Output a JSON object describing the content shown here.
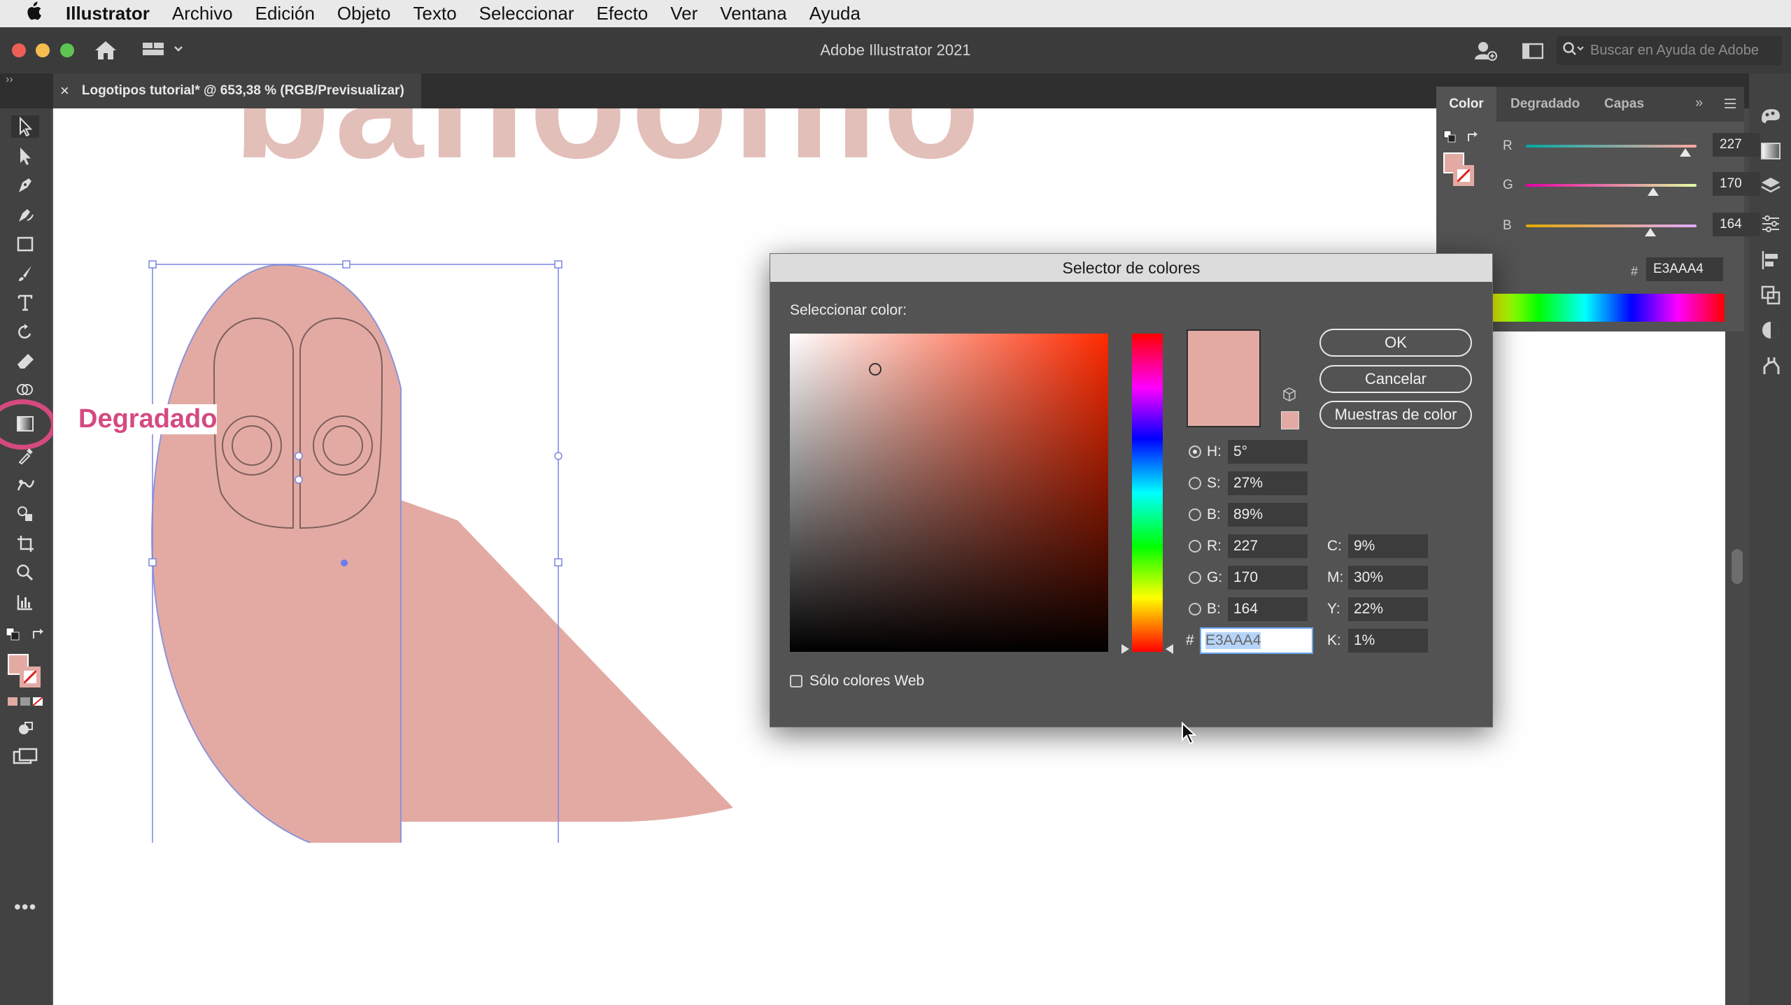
{
  "menubar": {
    "apple": "",
    "app": "Illustrator",
    "items": [
      "Archivo",
      "Edición",
      "Objeto",
      "Texto",
      "Seleccionar",
      "Efecto",
      "Ver",
      "Ventana",
      "Ayuda"
    ]
  },
  "appbar": {
    "title": "Adobe Illustrator 2021",
    "search_placeholder": "Buscar en Ayuda de Adobe"
  },
  "document_tab": {
    "close": "×",
    "title": "Logotipos tutorial* @ 653,38 % (RGB/Previsualizar)"
  },
  "annotation": {
    "label": "Degradado",
    "color": "#d44a7f"
  },
  "canvas": {
    "artwork_fill": "#e3aaa4",
    "background_text": "bahoohio"
  },
  "color_panel": {
    "tabs": [
      "Color",
      "Degradado",
      "Capas"
    ],
    "sliders": [
      {
        "label": "R",
        "value": "227"
      },
      {
        "label": "G",
        "value": "170"
      },
      {
        "label": "B",
        "value": "164"
      }
    ],
    "hex_label": "#",
    "hex_value": "E3AAA4"
  },
  "dialog": {
    "title": "Selector de colores",
    "select_label": "Seleccionar color:",
    "buttons": {
      "ok": "OK",
      "cancel": "Cancelar",
      "swatches": "Muestras de color"
    },
    "hsb": [
      {
        "label": "H:",
        "value": "5°",
        "selected": true
      },
      {
        "label": "S:",
        "value": "27%",
        "selected": false
      },
      {
        "label": "B:",
        "value": "89%",
        "selected": false
      }
    ],
    "rgb": [
      {
        "label": "R:",
        "value": "227",
        "selected": false
      },
      {
        "label": "G:",
        "value": "170",
        "selected": false
      },
      {
        "label": "B:",
        "value": "164",
        "selected": false
      }
    ],
    "hex_label": "#",
    "hex_value": "E3AAA4",
    "cmyk": [
      {
        "label": "C:",
        "value": "9%"
      },
      {
        "label": "M:",
        "value": "30%"
      },
      {
        "label": "Y:",
        "value": "22%"
      },
      {
        "label": "K:",
        "value": "1%"
      }
    ],
    "web_only_label": "Sólo colores Web",
    "web_only_checked": false,
    "current_color": "#e3aaa4"
  }
}
